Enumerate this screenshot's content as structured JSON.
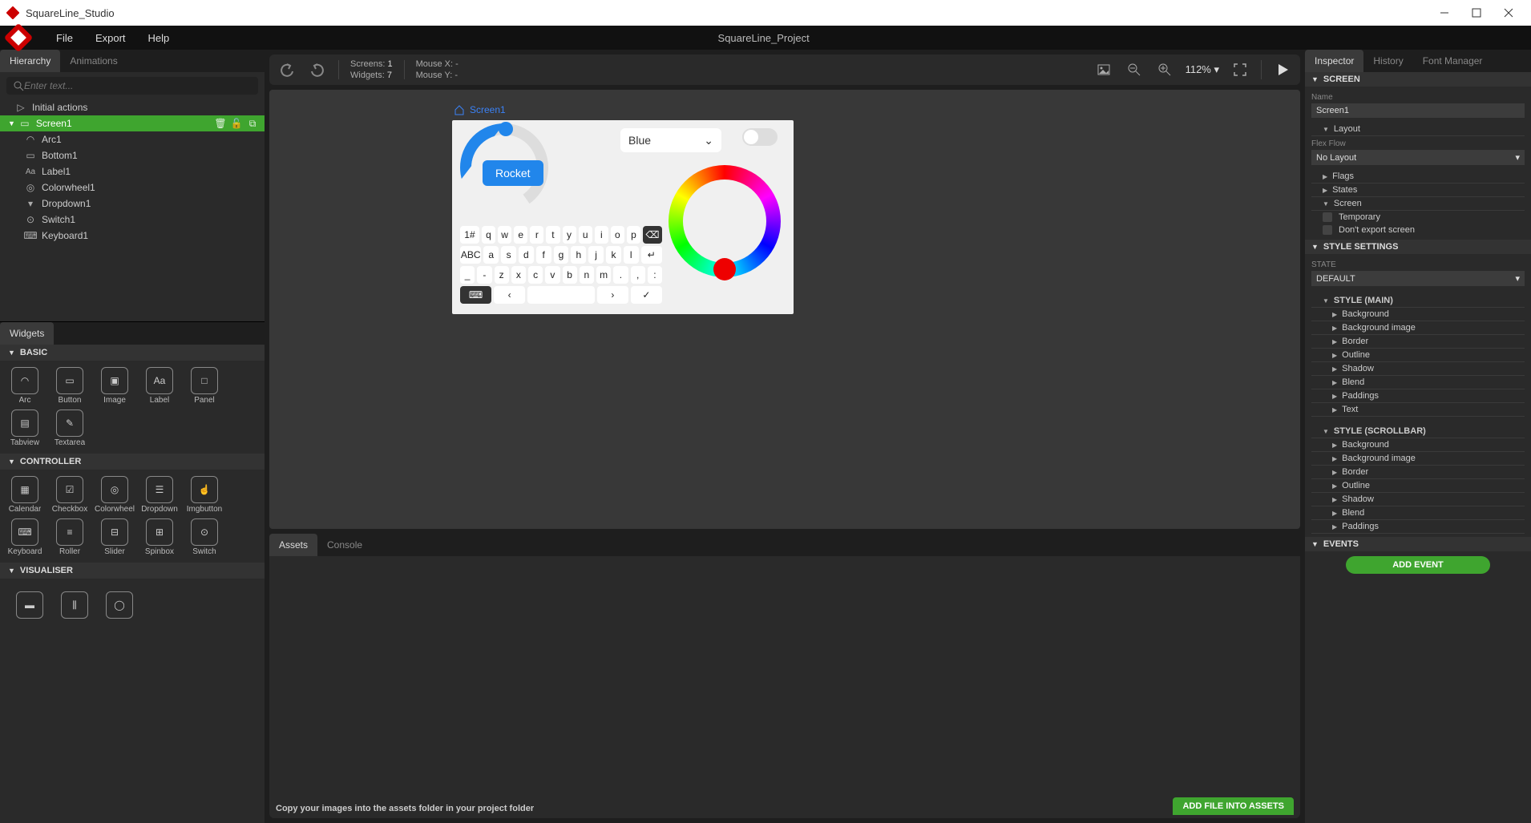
{
  "app": {
    "title": "SquareLine_Studio",
    "project": "SquareLine_Project"
  },
  "menu": {
    "items": [
      "File",
      "Export",
      "Help"
    ]
  },
  "left_tabs": {
    "hierarchy": "Hierarchy",
    "animations": "Animations"
  },
  "search": {
    "placeholder": "Enter text..."
  },
  "hierarchy": {
    "initial": "Initial actions",
    "screen": "Screen1",
    "items": [
      "Arc1",
      "Bottom1",
      "Label1",
      "Colorwheel1",
      "Dropdown1",
      "Switch1",
      "Keyboard1"
    ]
  },
  "widgets_tab": "Widgets",
  "widget_sections": {
    "basic": {
      "title": "BASIC",
      "items": [
        "Arc",
        "Button",
        "Image",
        "Label",
        "Panel",
        "Tabview",
        "Textarea"
      ]
    },
    "controller": {
      "title": "CONTROLLER",
      "items": [
        "Calendar",
        "Checkbox",
        "Colorwheel",
        "Dropdown",
        "Imgbutton",
        "Keyboard",
        "Roller",
        "Slider",
        "Spinbox",
        "Switch"
      ]
    },
    "visualiser": {
      "title": "VISUALISER"
    }
  },
  "toolbar": {
    "screens_lbl": "Screens:",
    "screens_val": "1",
    "widgets_lbl": "Widgets:",
    "widgets_val": "7",
    "mousex_lbl": "Mouse X:",
    "mousex_val": "-",
    "mousey_lbl": "Mouse Y:",
    "mousey_val": "-",
    "zoom": "112% ▾"
  },
  "preview": {
    "screen_label": "Screen1",
    "button_label": "Rocket",
    "dropdown_value": "Blue",
    "kb": {
      "r1": [
        "1#",
        "q",
        "w",
        "e",
        "r",
        "t",
        "y",
        "u",
        "i",
        "o",
        "p",
        "⌫"
      ],
      "r2": [
        "ABC",
        "a",
        "s",
        "d",
        "f",
        "g",
        "h",
        "j",
        "k",
        "l",
        "↵"
      ],
      "r3": [
        "_",
        "-",
        "z",
        "x",
        "c",
        "v",
        "b",
        "n",
        "m",
        ".",
        ",",
        ":"
      ],
      "r4": [
        "⌨",
        "‹",
        "",
        "›",
        "✓"
      ]
    }
  },
  "bottom_tabs": {
    "assets": "Assets",
    "console": "Console"
  },
  "assets": {
    "msg": "Copy your images into the assets folder in your project folder",
    "add_btn": "ADD FILE INTO ASSETS"
  },
  "inspector": {
    "tabs": {
      "inspector": "Inspector",
      "history": "History",
      "fontmgr": "Font Manager"
    },
    "screen_section": "SCREEN",
    "name_lbl": "Name",
    "name_val": "Screen1",
    "layout_sub": "Layout",
    "flexflow_lbl": "Flex Flow",
    "flexflow_val": "No Layout",
    "subs1": [
      "Flags",
      "States",
      "Screen"
    ],
    "checks": [
      "Temporary",
      "Don't export screen"
    ],
    "style_section": "STYLE SETTINGS",
    "state_lbl": "STATE",
    "state_val": "DEFAULT",
    "style_main": "STYLE (MAIN)",
    "style_main_items": [
      "Background",
      "Background image",
      "Border",
      "Outline",
      "Shadow",
      "Blend",
      "Paddings",
      "Text"
    ],
    "style_scroll": "STYLE (SCROLLBAR)",
    "style_scroll_items": [
      "Background",
      "Background image",
      "Border",
      "Outline",
      "Shadow",
      "Blend",
      "Paddings"
    ],
    "events_section": "EVENTS",
    "add_event": "ADD EVENT"
  }
}
